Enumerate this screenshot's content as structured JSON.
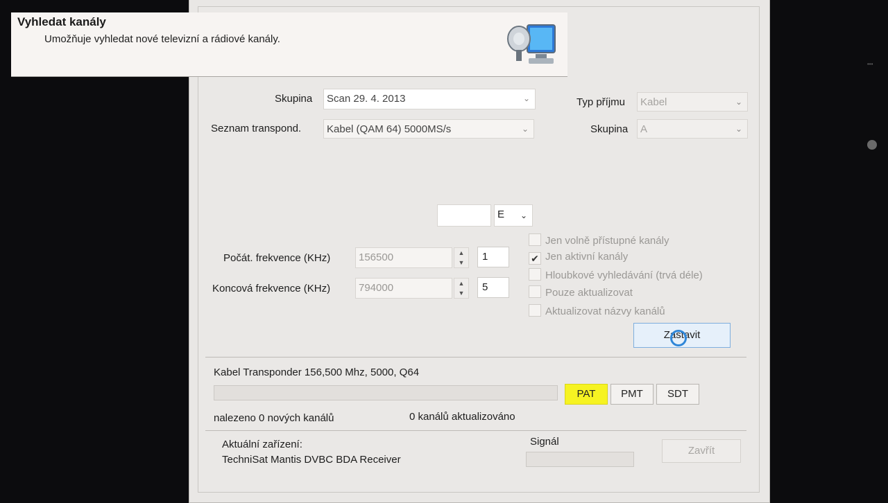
{
  "header": {
    "title": "Vyhledat kanály",
    "subtitle": "Umožňuje vyhledat nové televizní a rádiové kanály.",
    "icon": "satellite-computer-icon"
  },
  "form": {
    "group_label": "Skupina",
    "group_value": "Scan 29. 4. 2013",
    "transponder_list_label": "Seznam transpond.",
    "transponder_list_value": "Kabel (QAM 64) 5000MS/s",
    "reception_type_label": "Typ příjmu",
    "reception_type_value": "Kabel",
    "right_group_label": "Skupina",
    "right_group_value": "A",
    "channel_input_value": "",
    "band_select_value": "E",
    "start_freq_label": "Počát. frekvence (KHz)",
    "start_freq_value": "156500",
    "start_channel_value": "1",
    "end_freq_label": "Koncová frekvence (KHz)",
    "end_freq_value": "794000",
    "end_channel_value": "5"
  },
  "options": [
    {
      "label": "Jen volně přístupné kanály",
      "checked": false
    },
    {
      "label": "Jen aktivní kanály",
      "checked": true
    },
    {
      "label": "Hloubkové vyhledávání (trvá déle)",
      "checked": false
    },
    {
      "label": "Pouze aktualizovat",
      "checked": false
    },
    {
      "label": "Aktualizovat názvy kanálů",
      "checked": false
    }
  ],
  "actions": {
    "stop_label": "Zastavit",
    "close_label": "Zavřít"
  },
  "status": {
    "transponder_text": "Kabel Transponder 156,500 Mhz, 5000, Q64",
    "scan_progress": 0,
    "tables": [
      "PAT",
      "PMT",
      "SDT"
    ],
    "active_table": "PAT",
    "found_text": "nalezeno 0 nových kanálů",
    "updated_text": "0 kanálů aktualizováno"
  },
  "device": {
    "label": "Aktuální zařízení:",
    "name": "TechniSat Mantis DVBC BDA Receiver",
    "signal_label": "Signál",
    "signal_level": 0
  },
  "colors": {
    "active_table_bg": "#f6f322",
    "cursor": "#2e86d8"
  }
}
